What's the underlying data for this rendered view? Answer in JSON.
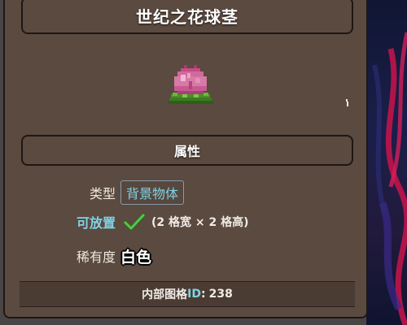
{
  "infobox": {
    "title": "世纪之花球茎",
    "section_title": "属性",
    "item_sprite": "plantera-bulb-sprite",
    "properties": {
      "type_label": "类型",
      "type_value": "背景物体",
      "placeable_label": "可放置",
      "placeable_icon": "check-icon",
      "placeable_size": "(2 格宽 × 2 格高)",
      "rarity_label": "稀有度",
      "rarity_value": "白色"
    },
    "footer": {
      "internal_id_label_prefix": "内部图格",
      "internal_id_label_suffix": "ID",
      "internal_id_colon": ":",
      "internal_id_value": "238"
    }
  },
  "colors": {
    "panel_bg": "#5a4a40",
    "border": "#1e1714",
    "link": "#7fd3e6",
    "check": "#5cc24a",
    "text": "#ffffff"
  }
}
